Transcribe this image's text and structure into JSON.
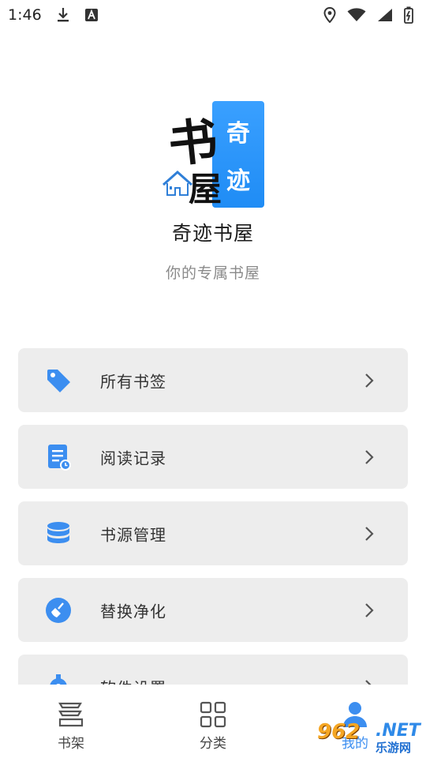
{
  "status_bar": {
    "time": "1:46",
    "icons": [
      "download-icon",
      "text-badge-icon",
      "location-icon",
      "wifi-icon",
      "signal-icon",
      "battery-icon"
    ]
  },
  "header": {
    "logo_big_char": "书",
    "logo_small_char": "屋",
    "logo_side_chars": [
      "奇",
      "迹"
    ],
    "app_name": "奇迹书屋",
    "slogan": "你的专属书屋"
  },
  "menu": {
    "items": [
      {
        "label": "所有书签",
        "icon": "tag-icon"
      },
      {
        "label": "阅读记录",
        "icon": "reading-history-icon"
      },
      {
        "label": "书源管理",
        "icon": "database-icon"
      },
      {
        "label": "替换净化",
        "icon": "broom-icon"
      },
      {
        "label": "软件设置",
        "icon": "settings-gear-icon"
      }
    ]
  },
  "bottom_nav": {
    "items": [
      {
        "label": "书架",
        "icon": "bookshelf-icon"
      },
      {
        "label": "分类",
        "icon": "grid-icon"
      },
      {
        "label": "我的",
        "icon": "profile-icon"
      }
    ]
  },
  "watermark": {
    "number": "962",
    "domain": ".NET",
    "site_name": "乐游网"
  },
  "colors": {
    "accent": "#3c8ef0",
    "card_bg": "#ededed",
    "text_primary": "#1a1a1a",
    "text_secondary": "#8a8a8a"
  }
}
